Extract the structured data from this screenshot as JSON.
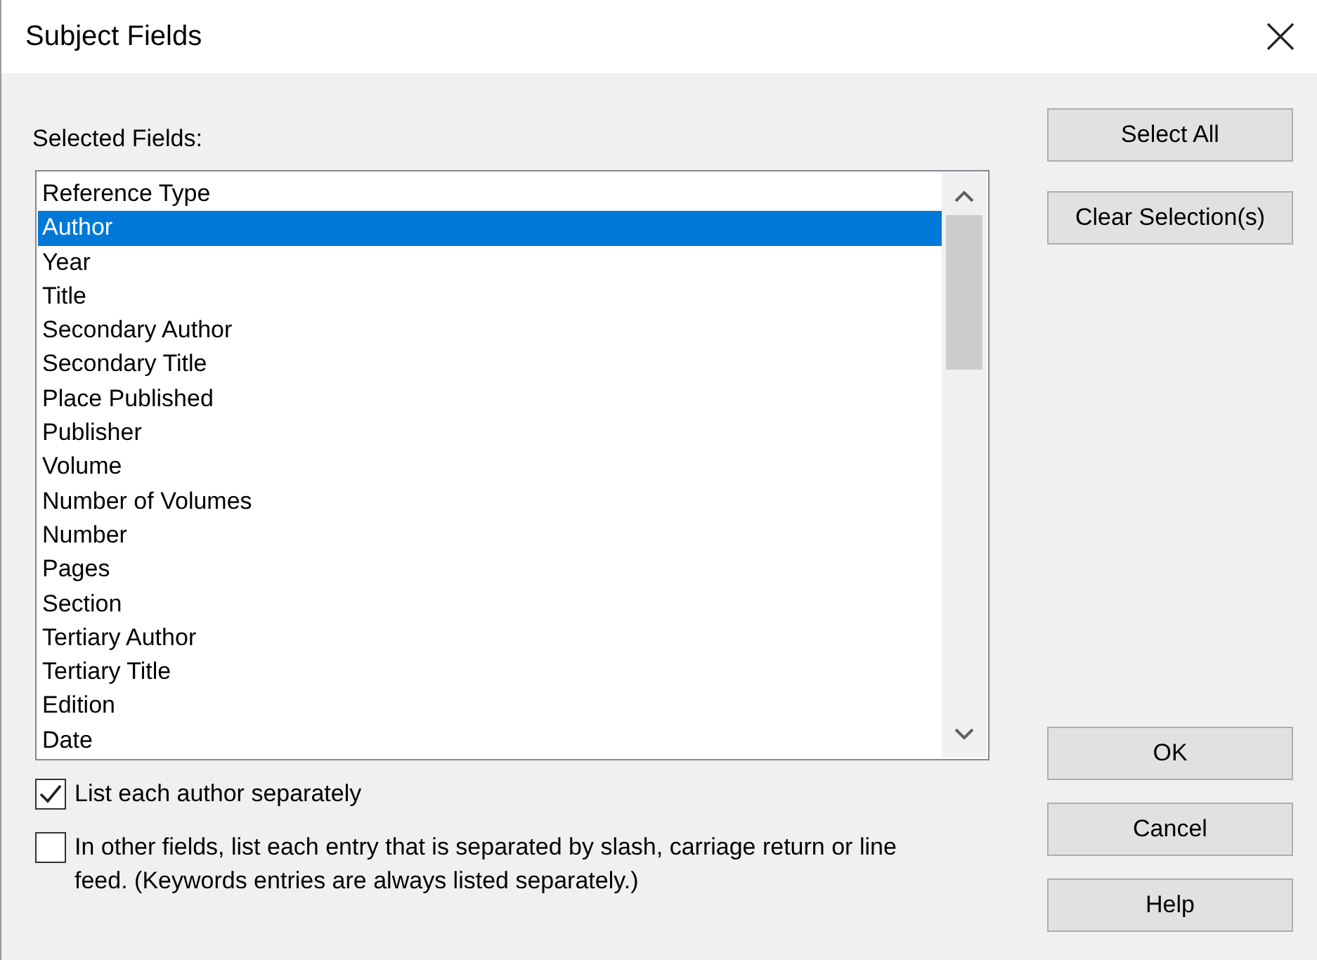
{
  "window": {
    "title": "Subject Fields"
  },
  "fields_label": "Selected Fields:",
  "fields": [
    {
      "label": "Reference Type",
      "selected": false
    },
    {
      "label": "Author",
      "selected": true
    },
    {
      "label": "Year",
      "selected": false
    },
    {
      "label": "Title",
      "selected": false
    },
    {
      "label": "Secondary Author",
      "selected": false
    },
    {
      "label": "Secondary Title",
      "selected": false
    },
    {
      "label": "Place Published",
      "selected": false
    },
    {
      "label": "Publisher",
      "selected": false
    },
    {
      "label": "Volume",
      "selected": false
    },
    {
      "label": "Number of Volumes",
      "selected": false
    },
    {
      "label": "Number",
      "selected": false
    },
    {
      "label": "Pages",
      "selected": false
    },
    {
      "label": "Section",
      "selected": false
    },
    {
      "label": "Tertiary Author",
      "selected": false
    },
    {
      "label": "Tertiary Title",
      "selected": false
    },
    {
      "label": "Edition",
      "selected": false
    },
    {
      "label": "Date",
      "selected": false
    }
  ],
  "options": [
    {
      "label": "List each author separately",
      "checked": true
    },
    {
      "label": "In other fields, list each entry that is separated by slash, carriage return or line feed. (Keywords entries are always listed separately.)",
      "checked": false
    }
  ],
  "top_buttons": [
    "Select All",
    "Clear Selection(s)"
  ],
  "bottom_buttons": [
    "OK",
    "Cancel",
    "Help"
  ]
}
